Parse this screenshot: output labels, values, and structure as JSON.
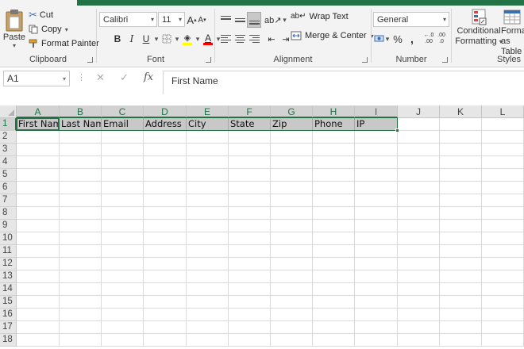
{
  "clipboard": {
    "paste_label": "Paste",
    "cut_label": "Cut",
    "copy_label": "Copy",
    "format_painter_label": "Format Painter",
    "group_label": "Clipboard"
  },
  "font": {
    "name": "Calibri",
    "size": "11",
    "grow_label": "A",
    "shrink_label": "A",
    "bold_label": "B",
    "italic_label": "I",
    "underline_label": "U",
    "fill_color": "#ffff00",
    "font_color": "#ff0000",
    "group_label": "Font"
  },
  "alignment": {
    "wrap_text_label": "Wrap Text",
    "merge_center_label": "Merge & Center",
    "group_label": "Alignment"
  },
  "number": {
    "format": "General",
    "currency_label": "$",
    "percent_label": "%",
    "comma_label": ",",
    "increase_decimal_label": ".00",
    "decrease_decimal_label": ".0",
    "group_label": "Number"
  },
  "styles": {
    "conditional_label_1": "Conditional",
    "conditional_label_2": "Formatting",
    "format_table_label_1": "Format as",
    "format_table_label_2": "Table",
    "group_label": "Styles"
  },
  "formula_bar": {
    "name_box": "A1",
    "cancel_symbol": "✕",
    "enter_symbol": "✓",
    "fx_label": "fx",
    "content": "First Name"
  },
  "sheet": {
    "columns": [
      "A",
      "B",
      "C",
      "D",
      "E",
      "F",
      "G",
      "H",
      "I",
      "J",
      "K",
      "L"
    ],
    "rows": [
      "1",
      "2",
      "3",
      "4",
      "5",
      "6",
      "7",
      "8",
      "9",
      "10",
      "11",
      "12",
      "13",
      "14",
      "15",
      "16",
      "17",
      "18"
    ],
    "header_row": [
      "First Name",
      "Last Name",
      "Email",
      "Address",
      "City",
      "State",
      "Zip",
      "Phone",
      "IP"
    ],
    "active_cell": "A1",
    "selection": "A1:I1"
  },
  "colors": {
    "accent": "#217346",
    "selected_fill": "#c8c8c8"
  }
}
